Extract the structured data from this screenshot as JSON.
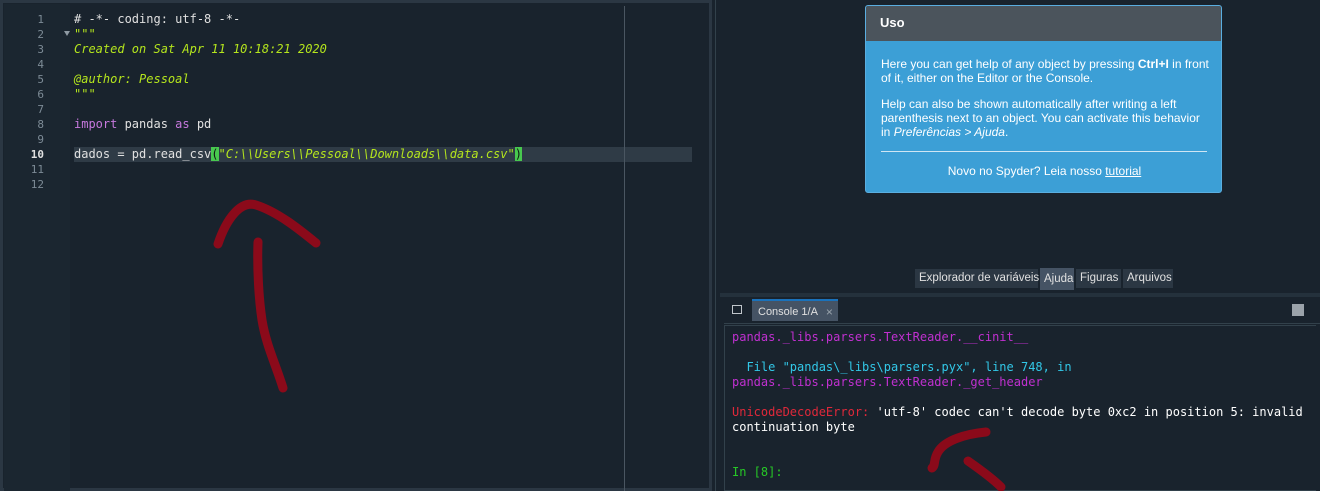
{
  "editor": {
    "line_numbers": [
      "1",
      "2",
      "3",
      "4",
      "5",
      "6",
      "7",
      "8",
      "9",
      "10",
      "11",
      "12"
    ],
    "active_line": "10",
    "lines": {
      "l1": "# -*- coding: utf-8 -*-",
      "l2": "\"\"\"",
      "l3": "Created on Sat Apr 11 10:18:21 2020",
      "l5": "@author: Pessoal",
      "l6": "\"\"\"",
      "l8_kw1": "import",
      "l8_mid": " pandas ",
      "l8_kw2": "as",
      "l8_end": " pd",
      "l10_pre": "dados = pd.read_csv",
      "l10_open": "(",
      "l10_str": "\"C:\\\\Users\\\\Pessoal\\\\Downloads\\\\data.csv\"",
      "l10_close": ")"
    }
  },
  "help": {
    "title": "Uso",
    "p1_pre": "Here you can get help of any object by pressing ",
    "p1_key": "Ctrl+I",
    "p1_post": " in front of it, either on the Editor or the Console.",
    "p2_pre": "Help can also be shown automatically after writing a left parenthesis next to an object. You can activate this behavior in ",
    "p2_link": "Preferências > Ajuda",
    "p2_post": ".",
    "foot_pre": "Novo no Spyder? Leia nosso ",
    "foot_link": "tutorial"
  },
  "tabs": {
    "variables": "Explorador de variáveis",
    "help": "Ajuda",
    "figures": "Figuras",
    "files": "Arquivos"
  },
  "console": {
    "tab_label": "Console 1/A",
    "close": "×",
    "lines": {
      "c1": "pandas._libs.parsers.TextReader.__cinit__",
      "c2": "  File \"pandas\\_libs\\parsers.pyx\", line 748, in",
      "c3": "pandas._libs.parsers.TextReader._get_header",
      "c4_err": "UnicodeDecodeError:",
      "c4_msg": " 'utf-8' codec can't decode byte 0xc2 in position 5: invalid",
      "c5": "continuation byte",
      "prompt": "In [8]:"
    }
  },
  "colors": {
    "background": "#19232d",
    "help_card": "#3c9fd6",
    "annotation": "#8b0a1a",
    "error": "#e0283a",
    "prompt": "#26c826"
  },
  "icons": {
    "console_options": "options-icon",
    "console_stop": "stop-icon",
    "fold": "fold-arrow-icon"
  }
}
